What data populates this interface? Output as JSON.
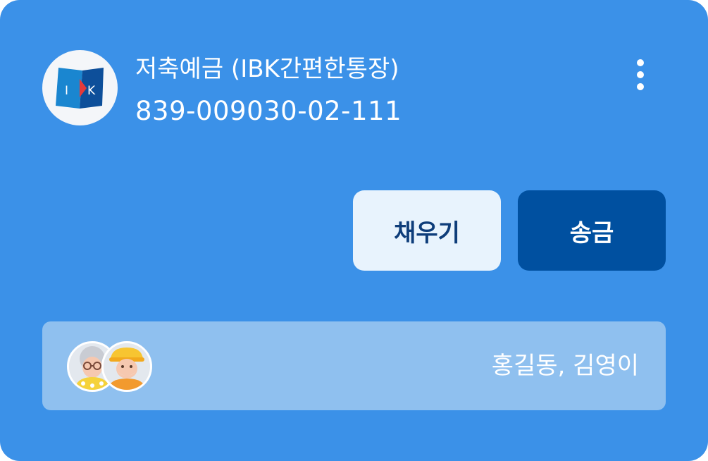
{
  "account": {
    "title": "저축예금 (IBK간편한통장)",
    "number": "839-009030-02-111",
    "bank_logo_icon": "ibk-logo-icon"
  },
  "actions": {
    "fill_label": "채우기",
    "send_label": "송금"
  },
  "members": {
    "names": "홍길동, 김영이",
    "avatars": [
      "grandmother-avatar",
      "grandfather-avatar"
    ]
  },
  "menu": {
    "icon": "more-vertical-icon"
  },
  "colors": {
    "card_background": "#3b91e8",
    "fill_button": "#e8f3fd",
    "send_button": "#0050a0",
    "members_bar": "#8fc0ef"
  }
}
